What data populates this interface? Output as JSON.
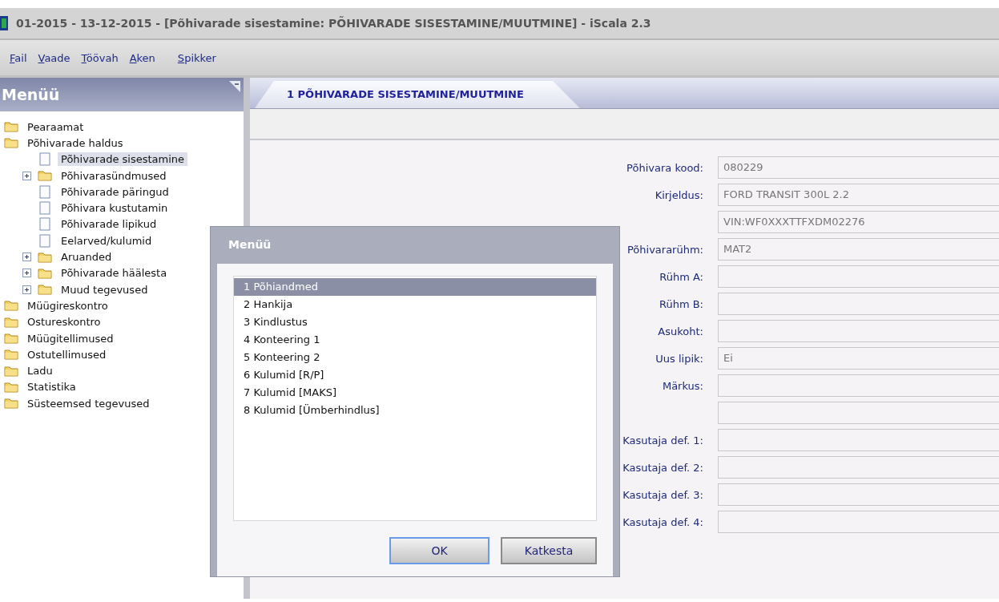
{
  "window": {
    "title": "01-2015 - 13-12-2015 - [Põhivarade sisestamine: PÕHIVARADE SISESTAMINE/MUUTMINE] - iScala 2.3"
  },
  "menu_bar": [
    "Fail",
    "Vaade",
    "Töövah",
    "Aken",
    "Spikker"
  ],
  "sidebar": {
    "title": "Menüü",
    "items": [
      {
        "label": "Pearaamat",
        "kind": "folder",
        "selected": false
      },
      {
        "label": "Põhivarade haldus",
        "kind": "folder",
        "selected": false,
        "children": [
          {
            "label": "Põhivarade sisestamine",
            "kind": "doc",
            "selected": true
          },
          {
            "label": "Põhivarasündmused",
            "kind": "folder",
            "selected": false,
            "expanded": false
          },
          {
            "label": "Põhivarade päringud",
            "kind": "doc",
            "selected": false
          },
          {
            "label": "Põhivara kustutamin",
            "kind": "doc",
            "selected": false
          },
          {
            "label": "Põhivarade lipikud",
            "kind": "doc",
            "selected": false
          },
          {
            "label": "Eelarved/kulumid",
            "kind": "doc",
            "selected": false
          },
          {
            "label": "Aruanded",
            "kind": "folder",
            "selected": false,
            "expanded": false
          },
          {
            "label": "Põhivarade häälesta",
            "kind": "folder",
            "selected": false,
            "expanded": false
          },
          {
            "label": "Muud tegevused",
            "kind": "folder",
            "selected": false,
            "expanded": false
          }
        ]
      },
      {
        "label": "Müügireskontro",
        "kind": "folder",
        "selected": false
      },
      {
        "label": "Ostureskontro",
        "kind": "folder",
        "selected": false
      },
      {
        "label": "Müügitellimused",
        "kind": "folder",
        "selected": false
      },
      {
        "label": "Ostutellimused",
        "kind": "folder",
        "selected": false
      },
      {
        "label": "Ladu",
        "kind": "folder",
        "selected": false
      },
      {
        "label": "Statistika",
        "kind": "folder",
        "selected": false
      },
      {
        "label": "Süsteemsed tegevused",
        "kind": "folder",
        "selected": false
      }
    ]
  },
  "tabs": [
    {
      "label": "1 PÕHIVARADE SISESTAMINE/MUUTMINE",
      "selected": true
    }
  ],
  "form": [
    {
      "kind": "filled",
      "label": "Põhivara kood:",
      "value": "080229"
    },
    {
      "kind": "filled",
      "label": "Kirjeldus:",
      "value": "FORD TRANSIT 300L 2.2"
    },
    {
      "kind": "filled",
      "value": "VIN:WF0XXXTTFXDM02276"
    },
    {
      "kind": "filled",
      "label": "Põhivararühm:",
      "value": "MAT2"
    },
    {
      "kind": "empty",
      "label": "Rühm A:"
    },
    {
      "kind": "empty",
      "label": "Rühm B:"
    },
    {
      "kind": "empty",
      "label": "Asukoht:"
    },
    {
      "kind": "filled",
      "label": "Uus lipik:",
      "value": "Ei"
    },
    {
      "kind": "empty",
      "label": "Märkus:"
    },
    {
      "kind": "empty"
    },
    {
      "kind": "empty",
      "label": "Kasutaja def. 1:"
    },
    {
      "kind": "empty",
      "label": "Kasutaja def. 2:"
    },
    {
      "kind": "empty",
      "label": "Kasutaja def. 3:"
    },
    {
      "kind": "empty",
      "label": "Kasutaja def. 4:"
    }
  ],
  "dialog": {
    "title": "Menüü",
    "items": [
      {
        "label": "1 Põhiandmed",
        "selected": true
      },
      {
        "label": "2 Hankija",
        "selected": false
      },
      {
        "label": "3 Kindlustus",
        "selected": false
      },
      {
        "label": "4 Konteering 1",
        "selected": false
      },
      {
        "label": "5 Konteering  2",
        "selected": false
      },
      {
        "label": "6 Kulumid [R/P]",
        "selected": false
      },
      {
        "label": "7 Kulumid [MAKS]",
        "selected": false
      },
      {
        "label": "8 Kulumid [Ümberhindlus]",
        "selected": false
      }
    ],
    "buttons": [
      {
        "label": "OK",
        "kind": "default"
      },
      {
        "label": "Katkesta",
        "kind": "normal"
      }
    ]
  }
}
